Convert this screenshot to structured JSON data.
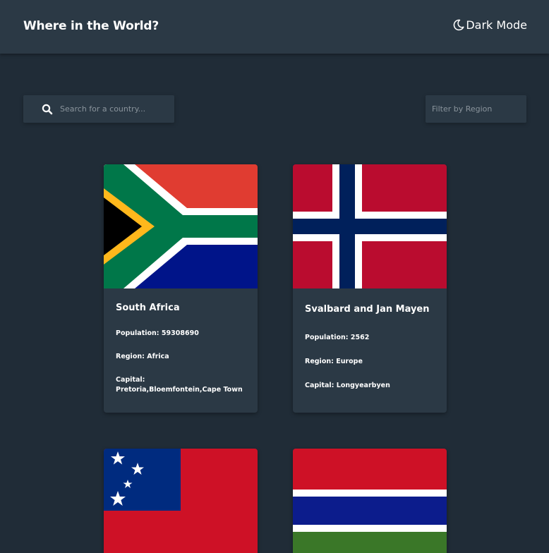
{
  "header": {
    "title": "Where in the World?",
    "mode_label": "Dark Mode",
    "mode_icon": "moon-icon"
  },
  "search": {
    "placeholder": "Search for a country...",
    "icon": "search-icon"
  },
  "filter": {
    "selected": "Filter by Region"
  },
  "colors": {
    "background": "#202c37",
    "element": "#2b3945",
    "text": "#ffffff"
  },
  "countries": [
    {
      "name": "South Africa",
      "population_label": "Population:",
      "population": "59308690",
      "region_label": "Region:",
      "region": "Africa",
      "capital_label": "Capital:",
      "capital": "Pretoria,Bloemfontein,Cape Town"
    },
    {
      "name": "Svalbard and Jan Mayen",
      "population_label": "Population:",
      "population": "2562",
      "region_label": "Region:",
      "region": "Europe",
      "capital_label": "Capital:",
      "capital": "Longyearbyen"
    },
    {
      "flag": "samoa-flag"
    },
    {
      "flag": "gambia-flag"
    }
  ]
}
